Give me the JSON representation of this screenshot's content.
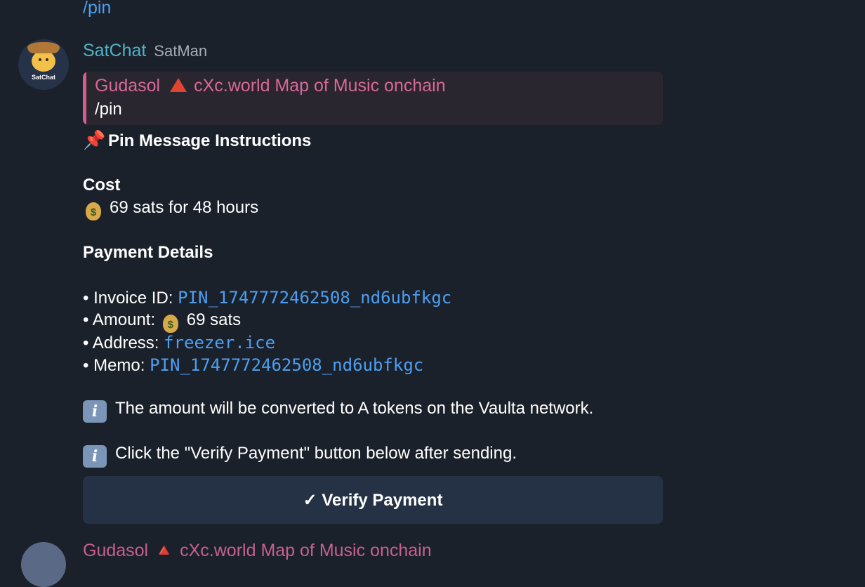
{
  "previous_message": {
    "text": "/pin"
  },
  "message": {
    "avatar_label": "SatChat",
    "bot_name": "SatChat",
    "user_name": "SatMan",
    "reply": {
      "author": "Gudasol",
      "title": "cXc.world Map of Music onchain",
      "text": "/pin"
    },
    "heading": "Pin Message Instructions",
    "cost_label": "Cost",
    "cost_text": "69 sats for 48 hours",
    "details_label": "Payment Details",
    "invoice_label": "• Invoice ID: ",
    "invoice_id": "PIN_1747772462508_nd6ubfkgc",
    "amount_label": "• Amount: ",
    "amount_text": "69 sats",
    "address_label": "• Address: ",
    "address": "freezer.ice",
    "memo_label": "• Memo: ",
    "memo": "PIN_1747772462508_nd6ubfkgc",
    "info1": "The amount will be converted to A tokens on the Vaulta network.",
    "info2": "Click the \"Verify Payment\" button below after sending.",
    "verify_button": "✓ Verify Payment"
  },
  "next_message": {
    "sender_preview": "Gudasol 🔺 cXc.world Map of Music onchain"
  },
  "colors": {
    "background": "#1b212b",
    "link": "#4c9ff1",
    "bot_name": "#4fb3c5",
    "reply_accent": "#d95b8d",
    "button_bg": "#253245"
  }
}
